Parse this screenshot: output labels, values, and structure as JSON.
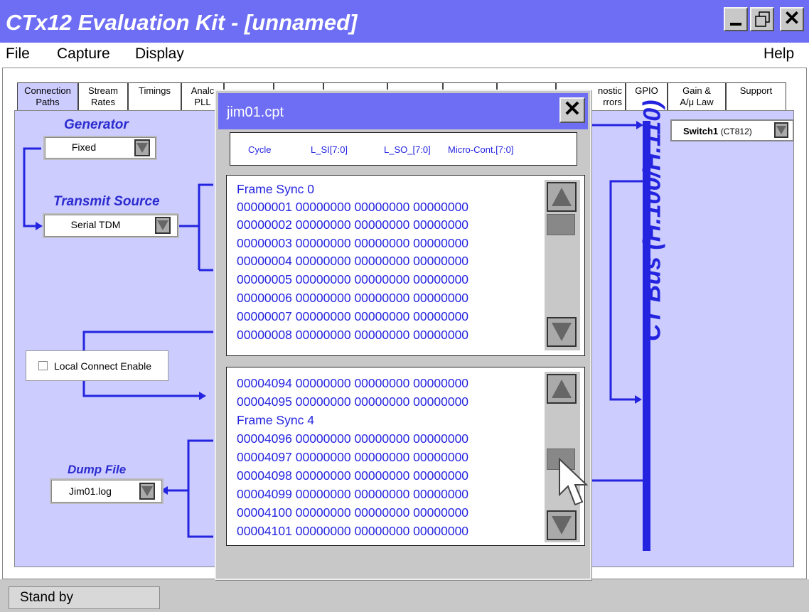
{
  "window": {
    "title": "CTx12 Evaluation Kit - [unnamed]",
    "minimize_icon": "minimize-icon",
    "maximize_icon": "maximize-icon",
    "close_label": "✕"
  },
  "menu": {
    "file": "File",
    "capture": "Capture",
    "display": "Display",
    "help": "Help"
  },
  "tabs": [
    {
      "line1": "Connection",
      "line2": "Paths"
    },
    {
      "line1": "Stream",
      "line2": "Rates"
    },
    {
      "line1": "Timings",
      "line2": ""
    },
    {
      "line1": "Analc",
      "line2": "PLL"
    },
    {
      "line1": "nostic",
      "line2": "rrors"
    },
    {
      "line1": "GPIO",
      "line2": ""
    },
    {
      "line1": "Gain &",
      "line2": "A/μ Law"
    },
    {
      "line1": "Support",
      "line2": ""
    }
  ],
  "generator": {
    "label": "Generator",
    "value": "Fixed"
  },
  "transmit": {
    "label": "Transmit Source",
    "value": "Serial TDM"
  },
  "local_connect": {
    "label": "Local Connect Enable",
    "checked": false
  },
  "dump": {
    "label": "Dump File",
    "value": "Jim01.log"
  },
  "switch": {
    "name": "Switch1",
    "model": "(CT812)"
  },
  "ctbus": {
    "label": "CT Bus (H.100/H.110)"
  },
  "status": {
    "text": "Stand by"
  },
  "dialog": {
    "title": "jim01.cpt",
    "close_label": "✕",
    "columns": [
      "Cycle",
      "L_SI[7:0]",
      "L_SO_[7:0]",
      "Micro-Cont.[7:0]"
    ],
    "pane1": [
      "Frame Sync 0",
      "00000001 00000000 00000000 00000000",
      "00000002 00000000 00000000 00000000",
      "00000003 00000000 00000000 00000000",
      "00000004 00000000 00000000 00000000",
      "00000005 00000000 00000000 00000000",
      "00000006 00000000 00000000 00000000",
      "00000007 00000000 00000000 00000000",
      "00000008 00000000 00000000 00000000"
    ],
    "pane2": [
      "00004094 00000000 00000000 00000000",
      "00004095 00000000 00000000 00000000",
      "Frame Sync 4",
      "00004096 00000000 00000000 00000000",
      "00004097 00000000 00000000 00000000",
      "00004098 00000000 00000000 00000000",
      "00004099 00000000 00000000 00000000",
      "00004100 00000000 00000000 00000000",
      "00004101 00000000 00000000 00000000"
    ]
  },
  "colors": {
    "titlebar": "#6e6ef5",
    "panel": "#ccccff",
    "accent": "#2424e0"
  }
}
